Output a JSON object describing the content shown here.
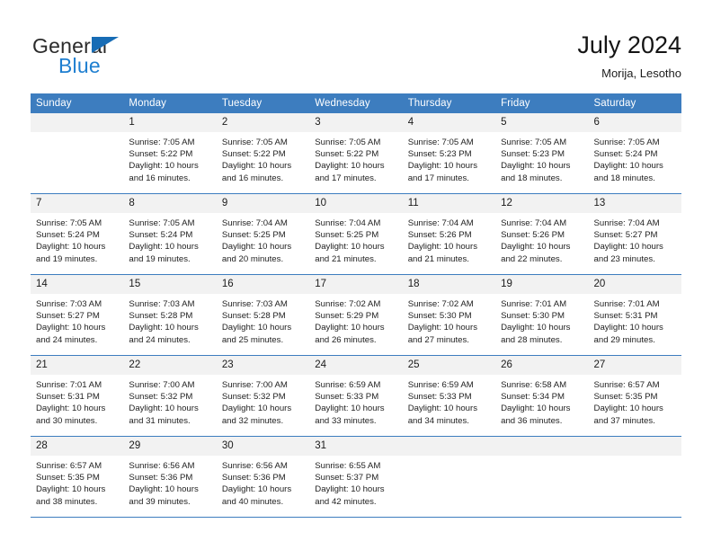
{
  "brand": {
    "name_part1": "General",
    "name_part2": "Blue",
    "triangle_color": "#176cb5",
    "blue_text_color": "#1f7fd0"
  },
  "header": {
    "month_title": "July 2024",
    "location": "Morija, Lesotho"
  },
  "theme": {
    "header_blue": "#3d7dbf",
    "daynum_band": "#f2f2f2",
    "cell_background": "#ffffff",
    "text_color": "#222222"
  },
  "weekday_headers": [
    "Sunday",
    "Monday",
    "Tuesday",
    "Wednesday",
    "Thursday",
    "Friday",
    "Saturday"
  ],
  "weeks": [
    [
      {
        "day": "",
        "sunrise": "",
        "sunset": "",
        "daylight1": "",
        "daylight2": "",
        "empty": true
      },
      {
        "day": "1",
        "sunrise": "Sunrise: 7:05 AM",
        "sunset": "Sunset: 5:22 PM",
        "daylight1": "Daylight: 10 hours",
        "daylight2": "and 16 minutes.",
        "empty": false
      },
      {
        "day": "2",
        "sunrise": "Sunrise: 7:05 AM",
        "sunset": "Sunset: 5:22 PM",
        "daylight1": "Daylight: 10 hours",
        "daylight2": "and 16 minutes.",
        "empty": false
      },
      {
        "day": "3",
        "sunrise": "Sunrise: 7:05 AM",
        "sunset": "Sunset: 5:22 PM",
        "daylight1": "Daylight: 10 hours",
        "daylight2": "and 17 minutes.",
        "empty": false
      },
      {
        "day": "4",
        "sunrise": "Sunrise: 7:05 AM",
        "sunset": "Sunset: 5:23 PM",
        "daylight1": "Daylight: 10 hours",
        "daylight2": "and 17 minutes.",
        "empty": false
      },
      {
        "day": "5",
        "sunrise": "Sunrise: 7:05 AM",
        "sunset": "Sunset: 5:23 PM",
        "daylight1": "Daylight: 10 hours",
        "daylight2": "and 18 minutes.",
        "empty": false
      },
      {
        "day": "6",
        "sunrise": "Sunrise: 7:05 AM",
        "sunset": "Sunset: 5:24 PM",
        "daylight1": "Daylight: 10 hours",
        "daylight2": "and 18 minutes.",
        "empty": false
      }
    ],
    [
      {
        "day": "7",
        "sunrise": "Sunrise: 7:05 AM",
        "sunset": "Sunset: 5:24 PM",
        "daylight1": "Daylight: 10 hours",
        "daylight2": "and 19 minutes.",
        "empty": false
      },
      {
        "day": "8",
        "sunrise": "Sunrise: 7:05 AM",
        "sunset": "Sunset: 5:24 PM",
        "daylight1": "Daylight: 10 hours",
        "daylight2": "and 19 minutes.",
        "empty": false
      },
      {
        "day": "9",
        "sunrise": "Sunrise: 7:04 AM",
        "sunset": "Sunset: 5:25 PM",
        "daylight1": "Daylight: 10 hours",
        "daylight2": "and 20 minutes.",
        "empty": false
      },
      {
        "day": "10",
        "sunrise": "Sunrise: 7:04 AM",
        "sunset": "Sunset: 5:25 PM",
        "daylight1": "Daylight: 10 hours",
        "daylight2": "and 21 minutes.",
        "empty": false
      },
      {
        "day": "11",
        "sunrise": "Sunrise: 7:04 AM",
        "sunset": "Sunset: 5:26 PM",
        "daylight1": "Daylight: 10 hours",
        "daylight2": "and 21 minutes.",
        "empty": false
      },
      {
        "day": "12",
        "sunrise": "Sunrise: 7:04 AM",
        "sunset": "Sunset: 5:26 PM",
        "daylight1": "Daylight: 10 hours",
        "daylight2": "and 22 minutes.",
        "empty": false
      },
      {
        "day": "13",
        "sunrise": "Sunrise: 7:04 AM",
        "sunset": "Sunset: 5:27 PM",
        "daylight1": "Daylight: 10 hours",
        "daylight2": "and 23 minutes.",
        "empty": false
      }
    ],
    [
      {
        "day": "14",
        "sunrise": "Sunrise: 7:03 AM",
        "sunset": "Sunset: 5:27 PM",
        "daylight1": "Daylight: 10 hours",
        "daylight2": "and 24 minutes.",
        "empty": false
      },
      {
        "day": "15",
        "sunrise": "Sunrise: 7:03 AM",
        "sunset": "Sunset: 5:28 PM",
        "daylight1": "Daylight: 10 hours",
        "daylight2": "and 24 minutes.",
        "empty": false
      },
      {
        "day": "16",
        "sunrise": "Sunrise: 7:03 AM",
        "sunset": "Sunset: 5:28 PM",
        "daylight1": "Daylight: 10 hours",
        "daylight2": "and 25 minutes.",
        "empty": false
      },
      {
        "day": "17",
        "sunrise": "Sunrise: 7:02 AM",
        "sunset": "Sunset: 5:29 PM",
        "daylight1": "Daylight: 10 hours",
        "daylight2": "and 26 minutes.",
        "empty": false
      },
      {
        "day": "18",
        "sunrise": "Sunrise: 7:02 AM",
        "sunset": "Sunset: 5:30 PM",
        "daylight1": "Daylight: 10 hours",
        "daylight2": "and 27 minutes.",
        "empty": false
      },
      {
        "day": "19",
        "sunrise": "Sunrise: 7:01 AM",
        "sunset": "Sunset: 5:30 PM",
        "daylight1": "Daylight: 10 hours",
        "daylight2": "and 28 minutes.",
        "empty": false
      },
      {
        "day": "20",
        "sunrise": "Sunrise: 7:01 AM",
        "sunset": "Sunset: 5:31 PM",
        "daylight1": "Daylight: 10 hours",
        "daylight2": "and 29 minutes.",
        "empty": false
      }
    ],
    [
      {
        "day": "21",
        "sunrise": "Sunrise: 7:01 AM",
        "sunset": "Sunset: 5:31 PM",
        "daylight1": "Daylight: 10 hours",
        "daylight2": "and 30 minutes.",
        "empty": false
      },
      {
        "day": "22",
        "sunrise": "Sunrise: 7:00 AM",
        "sunset": "Sunset: 5:32 PM",
        "daylight1": "Daylight: 10 hours",
        "daylight2": "and 31 minutes.",
        "empty": false
      },
      {
        "day": "23",
        "sunrise": "Sunrise: 7:00 AM",
        "sunset": "Sunset: 5:32 PM",
        "daylight1": "Daylight: 10 hours",
        "daylight2": "and 32 minutes.",
        "empty": false
      },
      {
        "day": "24",
        "sunrise": "Sunrise: 6:59 AM",
        "sunset": "Sunset: 5:33 PM",
        "daylight1": "Daylight: 10 hours",
        "daylight2": "and 33 minutes.",
        "empty": false
      },
      {
        "day": "25",
        "sunrise": "Sunrise: 6:59 AM",
        "sunset": "Sunset: 5:33 PM",
        "daylight1": "Daylight: 10 hours",
        "daylight2": "and 34 minutes.",
        "empty": false
      },
      {
        "day": "26",
        "sunrise": "Sunrise: 6:58 AM",
        "sunset": "Sunset: 5:34 PM",
        "daylight1": "Daylight: 10 hours",
        "daylight2": "and 36 minutes.",
        "empty": false
      },
      {
        "day": "27",
        "sunrise": "Sunrise: 6:57 AM",
        "sunset": "Sunset: 5:35 PM",
        "daylight1": "Daylight: 10 hours",
        "daylight2": "and 37 minutes.",
        "empty": false
      }
    ],
    [
      {
        "day": "28",
        "sunrise": "Sunrise: 6:57 AM",
        "sunset": "Sunset: 5:35 PM",
        "daylight1": "Daylight: 10 hours",
        "daylight2": "and 38 minutes.",
        "empty": false
      },
      {
        "day": "29",
        "sunrise": "Sunrise: 6:56 AM",
        "sunset": "Sunset: 5:36 PM",
        "daylight1": "Daylight: 10 hours",
        "daylight2": "and 39 minutes.",
        "empty": false
      },
      {
        "day": "30",
        "sunrise": "Sunrise: 6:56 AM",
        "sunset": "Sunset: 5:36 PM",
        "daylight1": "Daylight: 10 hours",
        "daylight2": "and 40 minutes.",
        "empty": false
      },
      {
        "day": "31",
        "sunrise": "Sunrise: 6:55 AM",
        "sunset": "Sunset: 5:37 PM",
        "daylight1": "Daylight: 10 hours",
        "daylight2": "and 42 minutes.",
        "empty": false
      },
      {
        "day": "",
        "sunrise": "",
        "sunset": "",
        "daylight1": "",
        "daylight2": "",
        "empty": true
      },
      {
        "day": "",
        "sunrise": "",
        "sunset": "",
        "daylight1": "",
        "daylight2": "",
        "empty": true
      },
      {
        "day": "",
        "sunrise": "",
        "sunset": "",
        "daylight1": "",
        "daylight2": "",
        "empty": true
      }
    ]
  ]
}
